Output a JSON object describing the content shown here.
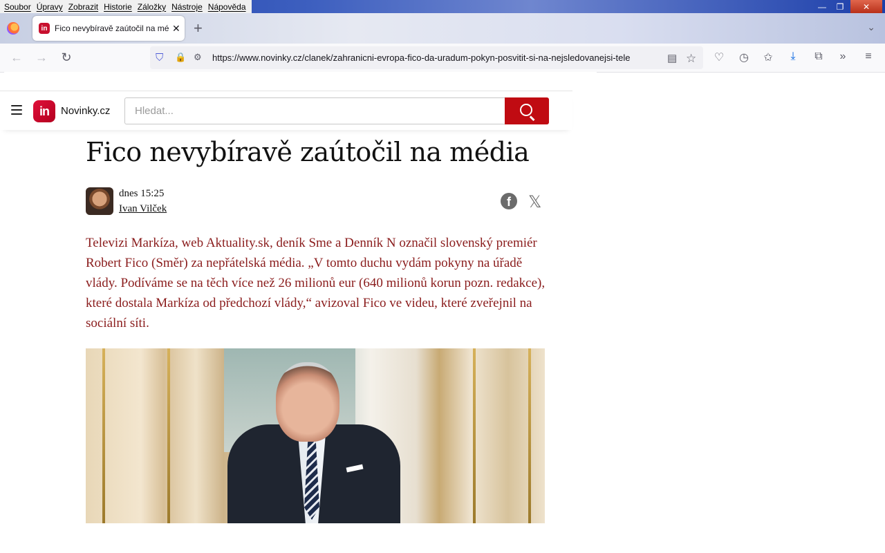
{
  "browser": {
    "menu": [
      "Soubor",
      "Úpravy",
      "Zobrazit",
      "Historie",
      "Záložky",
      "Nástroje",
      "Nápověda"
    ],
    "tab": {
      "title": "Fico nevybíravě zaútočil na méd",
      "close": "✕"
    },
    "new_tab": "+",
    "url": "https://www.novinky.cz/clanek/zahranicni-evropa-fico-da-uradum-pokyn-posvitit-si-na-nejsledovanejsi-tele",
    "icons": {
      "back": "←",
      "forward": "→",
      "reload": "↻",
      "shield": "⛉",
      "lock": "🔒",
      "perms": "⚙",
      "reader": "▤",
      "bookmark_star": "☆",
      "pocket": "♡",
      "history": "◷",
      "bookmarks": "✩",
      "downloads": "⤓",
      "extensions": "⧉",
      "overflow": "»",
      "menu": "≡",
      "tab_list": "⌄",
      "minimize": "—",
      "restore": "❐",
      "close": "✕"
    }
  },
  "site": {
    "logo_mark": "in",
    "name": "Novinky.cz",
    "search_placeholder": "Hledat..."
  },
  "article": {
    "title": "Fico nevybíravě zaútočil na média",
    "date": "dnes 15:25",
    "author": "Ivan Vilček",
    "share_facebook": "f",
    "share_x": "𝕏",
    "perex": "Televizi Markíza, web Aktuality.sk, deník Sme a Denník N označil slovenský premiér Robert Fico (Směr) za nepřátelská média. „V tomto duchu vydám pokyny na úřadě vlády. Podíváme se na těch více než 26 milionů eur (640 milionů korun pozn. redakce), které dostala Markíza od předchozí vlády,“ avizoval Fico ve videu, které zveřejnil na sociální síti."
  }
}
